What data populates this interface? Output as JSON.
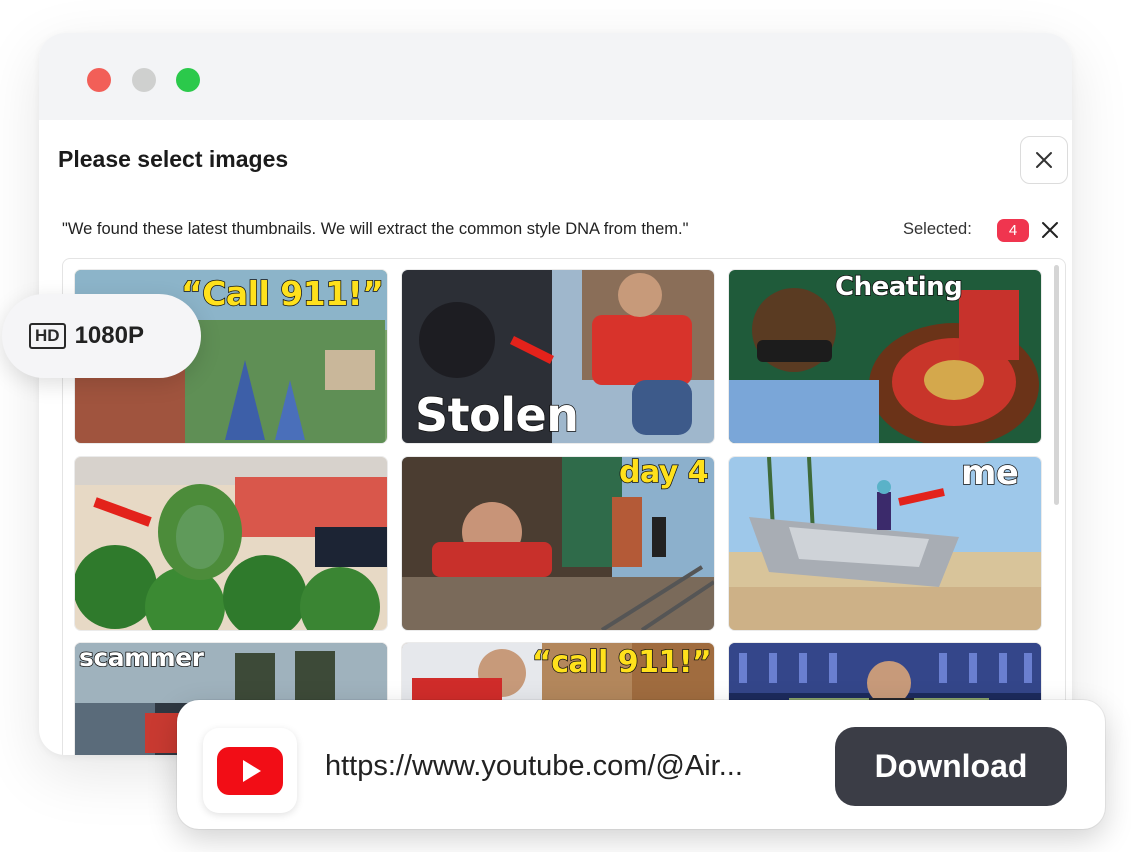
{
  "window": {
    "traffic_lights": [
      "red",
      "gray",
      "green"
    ],
    "colors": {
      "red": "#f25f58",
      "gray": "#cfd0cf",
      "green": "#2bc94b"
    }
  },
  "dialog": {
    "title": "Please select images",
    "subtitle": "\"We found these latest thumbnails. We will extract the common style DNA from them.\"",
    "selected_label": "Selected:",
    "selected_count": "4",
    "accent_color": "#f0354f"
  },
  "thumbnails": [
    {
      "caption": "“Call 911!”",
      "icon": "theme-park-aerial"
    },
    {
      "caption": "Stolen",
      "icon": "car-phone-theft"
    },
    {
      "caption": "Cheating",
      "icon": "roulette-casino"
    },
    {
      "caption": "",
      "icon": "watermelon-disguise"
    },
    {
      "caption": "day 4",
      "icon": "train-undercarriage"
    },
    {
      "caption": "me",
      "icon": "ufo-beach"
    },
    {
      "caption": "scammer",
      "icon": "scam-center-raid"
    },
    {
      "caption": "“call 911!”",
      "icon": "bed-wake-up"
    },
    {
      "caption": "",
      "icon": "crowd-money-stage"
    }
  ],
  "badge": {
    "hd": "HD",
    "resolution": "1080P"
  },
  "url_bar": {
    "url": "https://www.youtube.com/@Air...",
    "download_label": "Download",
    "icon": "youtube-icon"
  }
}
